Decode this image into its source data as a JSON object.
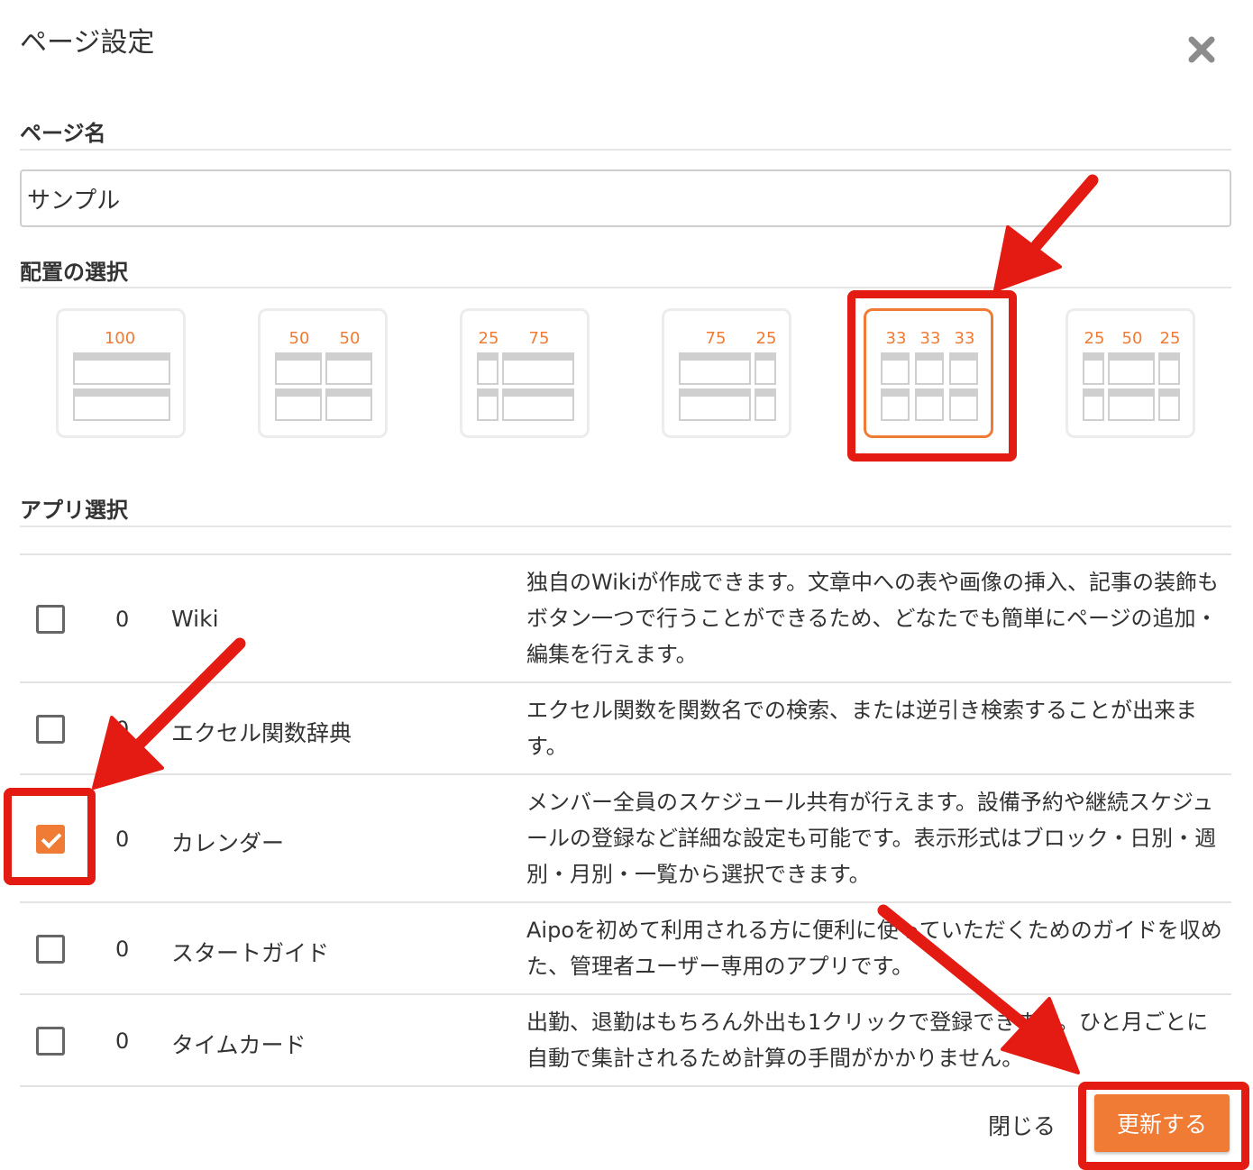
{
  "dialog": {
    "title": "ページ設定"
  },
  "page_name": {
    "label": "ページ名",
    "value": "サンプル"
  },
  "layout": {
    "label": "配置の選択",
    "selected": "33-33-33",
    "options": [
      {
        "id": "100",
        "numbers": [
          "100"
        ]
      },
      {
        "id": "50-50",
        "numbers": [
          "50",
          "50"
        ]
      },
      {
        "id": "25-75",
        "numbers": [
          "25",
          "75"
        ]
      },
      {
        "id": "75-25",
        "numbers": [
          "75",
          "25"
        ]
      },
      {
        "id": "33-33-33",
        "numbers": [
          "33",
          "33",
          "33"
        ]
      },
      {
        "id": "25-50-25",
        "numbers": [
          "25",
          "50",
          "25"
        ]
      }
    ]
  },
  "apps": {
    "label": "アプリ選択",
    "items": [
      {
        "checked": false,
        "count": "0",
        "name": "Wiki",
        "description": "独自のWikiが作成できます。文章中への表や画像の挿入、記事の装飾もボタン一つで行うことができるため、どなたでも簡単にページの追加・編集を行えます。"
      },
      {
        "checked": false,
        "count": "0",
        "name": "エクセル関数辞典",
        "description": "エクセル関数を関数名での検索、または逆引き検索することが出来ます。"
      },
      {
        "checked": true,
        "count": "0",
        "name": "カレンダー",
        "description": "メンバー全員のスケジュール共有が行えます。設備予約や継続スケジュールの登録など詳細な設定も可能です。表示形式はブロック・日別・週別・月別・一覧から選択できます。"
      },
      {
        "checked": false,
        "count": "0",
        "name": "スタートガイド",
        "description": "Aipoを初めて利用される方に便利に使っていただくためのガイドを収めた、管理者ユーザー専用のアプリです。"
      },
      {
        "checked": false,
        "count": "0",
        "name": "タイムカード",
        "description": "出勤、退勤はもちろん外出も1クリックで登録できます。ひと月ごとに自動で集計されるため計算の手間がかかりません。"
      }
    ]
  },
  "footer": {
    "close_label": "閉じる",
    "update_label": "更新する"
  },
  "colors": {
    "accent": "#ef7b35",
    "annotation": "#e31b12",
    "border": "#cfcfcf"
  }
}
